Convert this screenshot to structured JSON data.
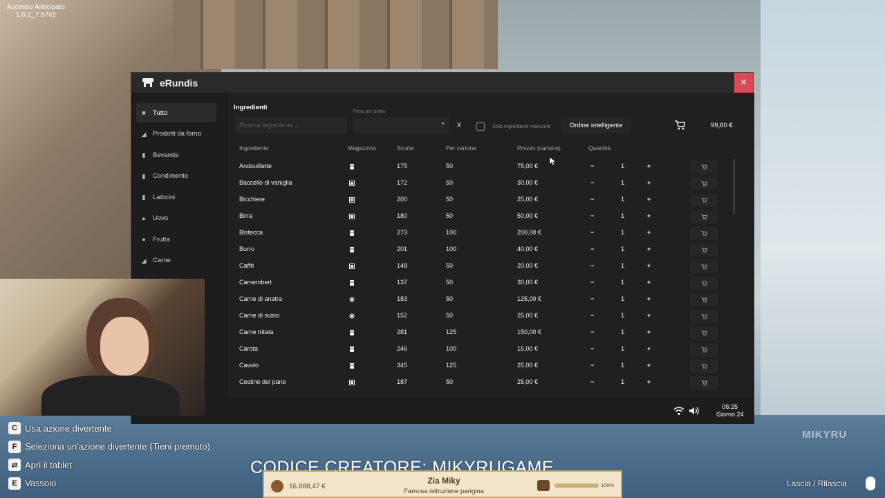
{
  "version": {
    "line1": "Accesso Anticipato",
    "line2": "1.0.2_7.b7c2"
  },
  "window": {
    "title": "eRundis",
    "close": "×"
  },
  "sidebar": {
    "items": [
      {
        "label": "Tutto",
        "icon": "square-icon"
      },
      {
        "label": "Prodotti da forno",
        "icon": "bread-icon"
      },
      {
        "label": "Bevande",
        "icon": "bottle-icon"
      },
      {
        "label": "Condimento",
        "icon": "jar-icon"
      },
      {
        "label": "Latticini",
        "icon": "milk-icon"
      },
      {
        "label": "Uovo",
        "icon": "egg-icon"
      },
      {
        "label": "Frutta",
        "icon": "fruit-icon"
      },
      {
        "label": "Carne",
        "icon": "meat-icon"
      }
    ]
  },
  "toolbar": {
    "section_title": "Ingredienti",
    "search_placeholder": "Ricerca Ingrediente...",
    "filter_label": "Filtra per piatto",
    "clear": "X",
    "missing_label": "Solo ingredienti mancanti",
    "smart_order": "Ordine intelligente",
    "cart_total": "99,60 €"
  },
  "table": {
    "headers": [
      "Ingrediente",
      "Magazzino",
      "Scorte",
      "Per cartone",
      "Prezzo (cartone)",
      "Quantità"
    ],
    "rows": [
      {
        "name": "Andouillette",
        "storage": "fridge",
        "stock": "175",
        "carton": "50",
        "price": "75,00 €",
        "qty": "1"
      },
      {
        "name": "Baccello di vaniglia",
        "storage": "shelf",
        "stock": "172",
        "carton": "50",
        "price": "30,00 €",
        "qty": "1"
      },
      {
        "name": "Bicchiere",
        "storage": "shelf",
        "stock": "200",
        "carton": "50",
        "price": "25,00 €",
        "qty": "1"
      },
      {
        "name": "Birra",
        "storage": "shelf",
        "stock": "180",
        "carton": "50",
        "price": "50,00 €",
        "qty": "1"
      },
      {
        "name": "Bistecca",
        "storage": "fridge",
        "stock": "273",
        "carton": "100",
        "price": "200,00 €",
        "qty": "1"
      },
      {
        "name": "Burro",
        "storage": "fridge",
        "stock": "201",
        "carton": "100",
        "price": "40,00 €",
        "qty": "1"
      },
      {
        "name": "Caffè",
        "storage": "shelf",
        "stock": "148",
        "carton": "50",
        "price": "20,00 €",
        "qty": "1"
      },
      {
        "name": "Camembert",
        "storage": "fridge",
        "stock": "137",
        "carton": "50",
        "price": "30,00 €",
        "qty": "1"
      },
      {
        "name": "Carne di anatra",
        "storage": "freezer",
        "stock": "183",
        "carton": "50",
        "price": "125,00 €",
        "qty": "1"
      },
      {
        "name": "Carne di suino",
        "storage": "freezer",
        "stock": "152",
        "carton": "50",
        "price": "25,00 €",
        "qty": "1"
      },
      {
        "name": "Carne tritata",
        "storage": "fridge",
        "stock": "281",
        "carton": "125",
        "price": "150,00 €",
        "qty": "1"
      },
      {
        "name": "Carota",
        "storage": "fridge",
        "stock": "246",
        "carton": "100",
        "price": "15,00 €",
        "qty": "1"
      },
      {
        "name": "Cavolo",
        "storage": "fridge",
        "stock": "345",
        "carton": "125",
        "price": "25,00 €",
        "qty": "1"
      },
      {
        "name": "Cestino del pane",
        "storage": "shelf",
        "stock": "187",
        "carton": "50",
        "price": "25,00 €",
        "qty": "1"
      }
    ],
    "minus": "−",
    "plus": "+"
  },
  "statusbar": {
    "time": "06:25",
    "day": "Giorno 24"
  },
  "hotkeys": [
    {
      "key": "C",
      "label": "Usa azione divertente"
    },
    {
      "key": "F",
      "label": "Seleziona un'azione divertente (Tieni premuto)"
    },
    {
      "key": "⇄",
      "label": "Apri il tablet"
    },
    {
      "key": "E",
      "label": "Vassoio"
    }
  ],
  "overlay": {
    "creator_code": "CODICE CREATORE: MIKYRUGAME"
  },
  "hud": {
    "money": "16.888,47 €",
    "name": "Zia Miky",
    "subtitle": "Famosa istituzione parigina",
    "satisfaction_pct": "100%",
    "satisfaction_fraction": 1.0
  },
  "drop_hint": "Lascia / Rilascia",
  "watermark": "MIKYRU",
  "colors": {
    "close_red": "#d94c55",
    "panel": "#1d1d1d",
    "row_bg": "#202020"
  }
}
